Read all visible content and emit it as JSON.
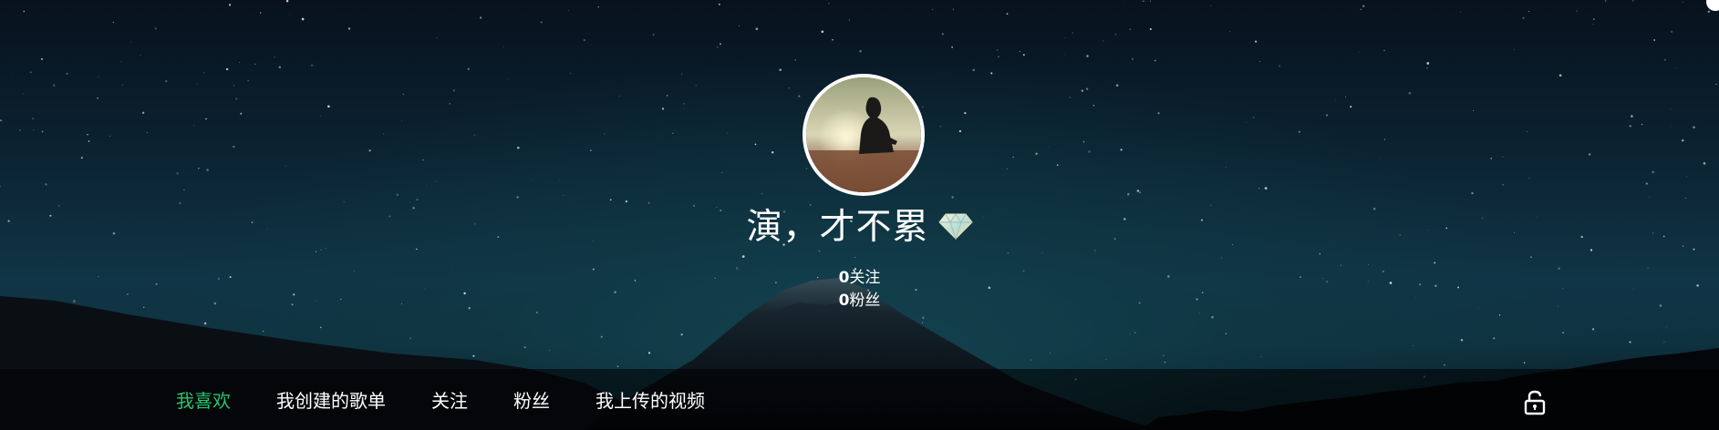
{
  "profile": {
    "nickname": "演，才不累",
    "vip_icon": "diamond-icon",
    "avatar_icon": "avatar-photo",
    "stats": [
      {
        "count": "0",
        "label": "关注"
      },
      {
        "count": "0",
        "label": "粉丝"
      }
    ]
  },
  "tabs": [
    {
      "label": "我喜欢",
      "active": true
    },
    {
      "label": "我创建的歌单",
      "active": false
    },
    {
      "label": "关注",
      "active": false
    },
    {
      "label": "粉丝",
      "active": false
    },
    {
      "label": "我上传的视频",
      "active": false
    }
  ],
  "privacy": {
    "icon": "unlock-icon"
  },
  "colors": {
    "active_tab": "#27c66f",
    "text": "#ffffff",
    "sky_top": "#07121d",
    "sky_bottom": "#103546"
  }
}
